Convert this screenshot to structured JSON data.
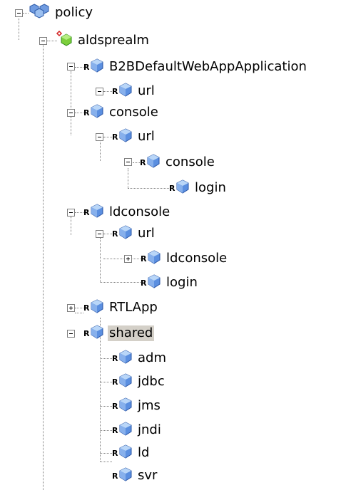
{
  "tree": {
    "root": {
      "label": "policy",
      "icon": "policy-group-icon"
    },
    "realm": {
      "label": "aldsprealm",
      "icon": "realm-icon"
    },
    "b2b": {
      "label": "B2BDefaultWebAppApplication",
      "prefix": "R",
      "icon": "resource-cube-icon"
    },
    "b2b_url": {
      "label": "url",
      "prefix": "R"
    },
    "console": {
      "label": "console",
      "prefix": "R"
    },
    "console_url": {
      "label": "url",
      "prefix": "R"
    },
    "console_url_console": {
      "label": "console",
      "prefix": "R"
    },
    "console_login": {
      "label": "login",
      "prefix": "R"
    },
    "ldconsole": {
      "label": "ldconsole",
      "prefix": "R"
    },
    "ldconsole_url": {
      "label": "url",
      "prefix": "R"
    },
    "ldconsole_url_ldconsole": {
      "label": "ldconsole",
      "prefix": "R"
    },
    "ldconsole_login": {
      "label": "login",
      "prefix": "R"
    },
    "rtlapp": {
      "label": "RTLApp",
      "prefix": "R"
    },
    "shared": {
      "label": "shared",
      "prefix": "R",
      "selected": true
    },
    "shared_children": [
      {
        "label": "adm",
        "prefix": "R"
      },
      {
        "label": "jdbc",
        "prefix": "R"
      },
      {
        "label": "jms",
        "prefix": "R"
      },
      {
        "label": "jndi",
        "prefix": "R"
      },
      {
        "label": "ld",
        "prefix": "R"
      },
      {
        "label": "svr",
        "prefix": "R"
      }
    ]
  },
  "colors": {
    "selection": "#d4d0c8",
    "connector": "#808080",
    "cube_light": "#a9c8f0",
    "cube_dark": "#2f5fb5"
  }
}
